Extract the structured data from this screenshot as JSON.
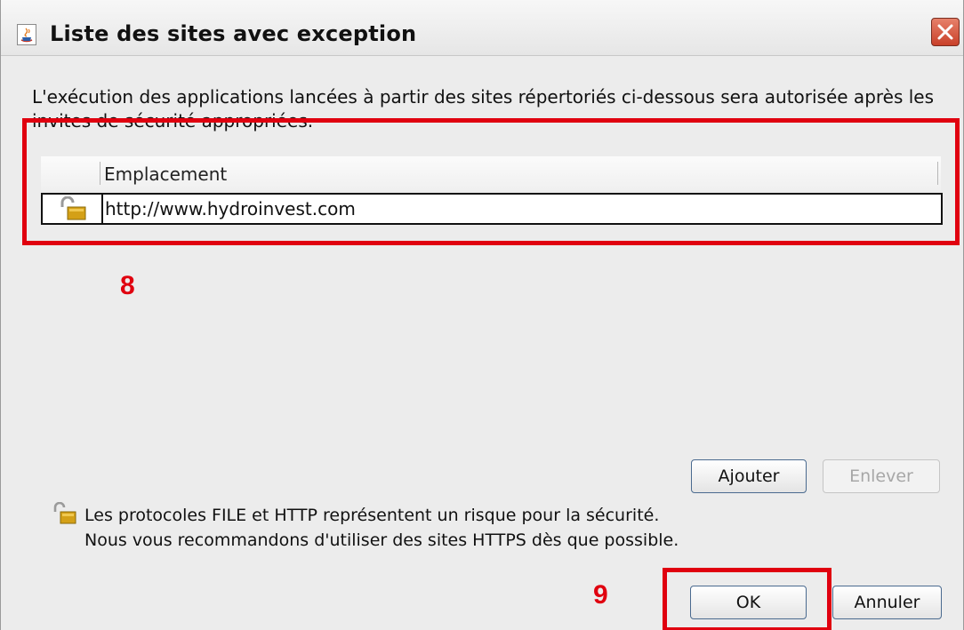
{
  "window": {
    "title": "Liste des sites avec exception"
  },
  "description": {
    "line1": "L'exécution des applications lancées à partir des sites répertoriés ci-dessous sera autorisée après les",
    "line2": "invites de sécurité appropriées."
  },
  "table": {
    "column_header": "Emplacement",
    "rows": [
      {
        "url": "http://www.hydroinvest.com",
        "icon": "unlocked-padlock-icon"
      }
    ]
  },
  "buttons": {
    "add": "Ajouter",
    "remove": "Enlever",
    "ok": "OK",
    "cancel": "Annuler"
  },
  "warning": {
    "line1": "Les protocoles FILE et HTTP représentent un risque pour la sécurité.",
    "line2": "Nous vous recommandons d'utiliser des sites HTTPS dès que possible."
  },
  "annotations": {
    "step_table": "8",
    "step_ok": "9",
    "highlight_color": "#e0000f"
  },
  "colors": {
    "close_button": "#c9412a",
    "dialog_background": "#ececec"
  }
}
